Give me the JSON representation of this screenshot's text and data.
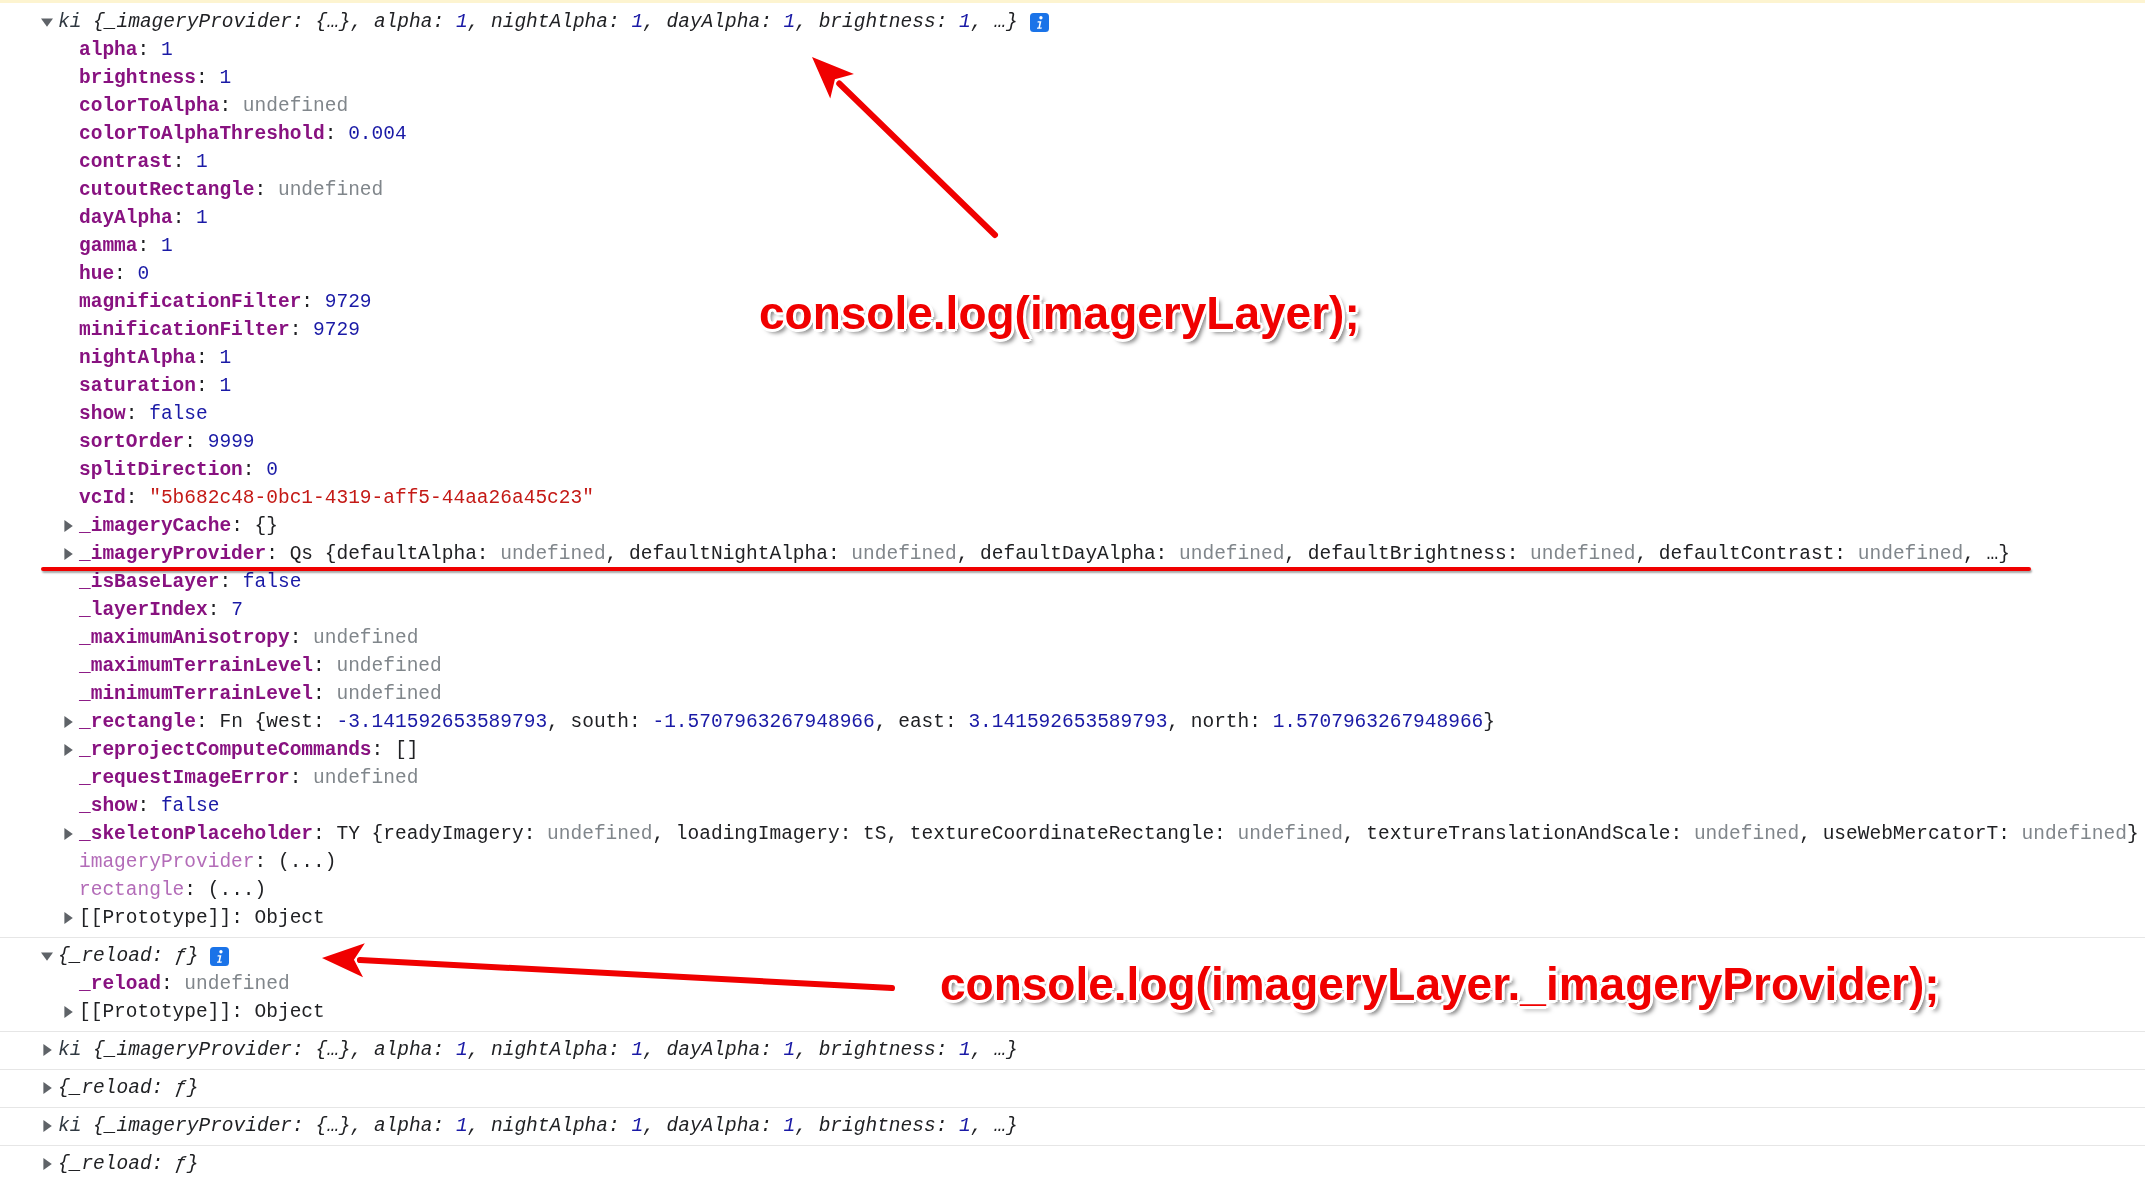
{
  "console": {
    "messages": [
      {
        "expanded": true,
        "info": true,
        "summary": [
          {
            "text": "ki ",
            "kind": "cls"
          },
          {
            "text": "{_imageryProvider: {…}, alpha: ",
            "kind": "p"
          },
          {
            "text": "1",
            "kind": "num"
          },
          {
            "text": ", nightAlpha: ",
            "kind": "p"
          },
          {
            "text": "1",
            "kind": "num"
          },
          {
            "text": ", dayAlpha: ",
            "kind": "p"
          },
          {
            "text": "1",
            "kind": "num"
          },
          {
            "text": ", brightness: ",
            "kind": "p"
          },
          {
            "text": "1",
            "kind": "num"
          },
          {
            "text": ", …}",
            "kind": "p"
          }
        ],
        "rows": [
          {
            "toggle": false,
            "key": "alpha",
            "kind": "own",
            "value": [
              {
                "text": ": ",
                "kind": "p"
              },
              {
                "text": "1",
                "kind": "num"
              }
            ]
          },
          {
            "toggle": false,
            "key": "brightness",
            "kind": "own",
            "value": [
              {
                "text": ": ",
                "kind": "p"
              },
              {
                "text": "1",
                "kind": "num"
              }
            ]
          },
          {
            "toggle": false,
            "key": "colorToAlpha",
            "kind": "own",
            "value": [
              {
                "text": ": ",
                "kind": "p"
              },
              {
                "text": "undefined",
                "kind": "undef"
              }
            ]
          },
          {
            "toggle": false,
            "key": "colorToAlphaThreshold",
            "kind": "own",
            "value": [
              {
                "text": ": ",
                "kind": "p"
              },
              {
                "text": "0.004",
                "kind": "num"
              }
            ]
          },
          {
            "toggle": false,
            "key": "contrast",
            "kind": "own",
            "value": [
              {
                "text": ": ",
                "kind": "p"
              },
              {
                "text": "1",
                "kind": "num"
              }
            ]
          },
          {
            "toggle": false,
            "key": "cutoutRectangle",
            "kind": "own",
            "value": [
              {
                "text": ": ",
                "kind": "p"
              },
              {
                "text": "undefined",
                "kind": "undef"
              }
            ]
          },
          {
            "toggle": false,
            "key": "dayAlpha",
            "kind": "own",
            "value": [
              {
                "text": ": ",
                "kind": "p"
              },
              {
                "text": "1",
                "kind": "num"
              }
            ]
          },
          {
            "toggle": false,
            "key": "gamma",
            "kind": "own",
            "value": [
              {
                "text": ": ",
                "kind": "p"
              },
              {
                "text": "1",
                "kind": "num"
              }
            ]
          },
          {
            "toggle": false,
            "key": "hue",
            "kind": "own",
            "value": [
              {
                "text": ": ",
                "kind": "p"
              },
              {
                "text": "0",
                "kind": "num"
              }
            ]
          },
          {
            "toggle": false,
            "key": "magnificationFilter",
            "kind": "own",
            "value": [
              {
                "text": ": ",
                "kind": "p"
              },
              {
                "text": "9729",
                "kind": "num"
              }
            ]
          },
          {
            "toggle": false,
            "key": "minificationFilter",
            "kind": "own",
            "value": [
              {
                "text": ": ",
                "kind": "p"
              },
              {
                "text": "9729",
                "kind": "num"
              }
            ]
          },
          {
            "toggle": false,
            "key": "nightAlpha",
            "kind": "own",
            "value": [
              {
                "text": ": ",
                "kind": "p"
              },
              {
                "text": "1",
                "kind": "num"
              }
            ]
          },
          {
            "toggle": false,
            "key": "saturation",
            "kind": "own",
            "value": [
              {
                "text": ": ",
                "kind": "p"
              },
              {
                "text": "1",
                "kind": "num"
              }
            ]
          },
          {
            "toggle": false,
            "key": "show",
            "kind": "own",
            "value": [
              {
                "text": ": ",
                "kind": "p"
              },
              {
                "text": "false",
                "kind": "bool"
              }
            ]
          },
          {
            "toggle": false,
            "key": "sortOrder",
            "kind": "own",
            "value": [
              {
                "text": ": ",
                "kind": "p"
              },
              {
                "text": "9999",
                "kind": "num"
              }
            ]
          },
          {
            "toggle": false,
            "key": "splitDirection",
            "kind": "own",
            "value": [
              {
                "text": ": ",
                "kind": "p"
              },
              {
                "text": "0",
                "kind": "num"
              }
            ]
          },
          {
            "toggle": false,
            "key": "vcId",
            "kind": "own",
            "value": [
              {
                "text": ": ",
                "kind": "p"
              },
              {
                "text": "\"5b682c48-0bc1-4319-aff5-44aa26a45c23\"",
                "kind": "str"
              }
            ]
          },
          {
            "toggle": true,
            "key": "_imageryCache",
            "kind": "own",
            "value": [
              {
                "text": ": {}",
                "kind": "p"
              }
            ]
          },
          {
            "toggle": true,
            "key": "_imageryProvider",
            "kind": "own",
            "value": [
              {
                "text": ": Qs {defaultAlpha: ",
                "kind": "p"
              },
              {
                "text": "undefined",
                "kind": "undef"
              },
              {
                "text": ", defaultNightAlpha: ",
                "kind": "p"
              },
              {
                "text": "undefined",
                "kind": "undef"
              },
              {
                "text": ", defaultDayAlpha: ",
                "kind": "p"
              },
              {
                "text": "undefined",
                "kind": "undef"
              },
              {
                "text": ", defaultBrightness: ",
                "kind": "p"
              },
              {
                "text": "undefined",
                "kind": "undef"
              },
              {
                "text": ", defaultContrast: ",
                "kind": "p"
              },
              {
                "text": "undefined",
                "kind": "undef"
              },
              {
                "text": ", …}",
                "kind": "p"
              }
            ]
          },
          {
            "toggle": false,
            "key": "_isBaseLayer",
            "kind": "own",
            "value": [
              {
                "text": ": ",
                "kind": "p"
              },
              {
                "text": "false",
                "kind": "bool"
              }
            ]
          },
          {
            "toggle": false,
            "key": "_layerIndex",
            "kind": "own",
            "value": [
              {
                "text": ": ",
                "kind": "p"
              },
              {
                "text": "7",
                "kind": "num"
              }
            ]
          },
          {
            "toggle": false,
            "key": "_maximumAnisotropy",
            "kind": "own",
            "value": [
              {
                "text": ": ",
                "kind": "p"
              },
              {
                "text": "undefined",
                "kind": "undef"
              }
            ]
          },
          {
            "toggle": false,
            "key": "_maximumTerrainLevel",
            "kind": "own",
            "value": [
              {
                "text": ": ",
                "kind": "p"
              },
              {
                "text": "undefined",
                "kind": "undef"
              }
            ]
          },
          {
            "toggle": false,
            "key": "_minimumTerrainLevel",
            "kind": "own",
            "value": [
              {
                "text": ": ",
                "kind": "p"
              },
              {
                "text": "undefined",
                "kind": "undef"
              }
            ]
          },
          {
            "toggle": true,
            "key": "_rectangle",
            "kind": "own",
            "value": [
              {
                "text": ": Fn {west: ",
                "kind": "p"
              },
              {
                "text": "-3.141592653589793",
                "kind": "num"
              },
              {
                "text": ", south: ",
                "kind": "p"
              },
              {
                "text": "-1.5707963267948966",
                "kind": "num"
              },
              {
                "text": ", east: ",
                "kind": "p"
              },
              {
                "text": "3.141592653589793",
                "kind": "num"
              },
              {
                "text": ", north: ",
                "kind": "p"
              },
              {
                "text": "1.5707963267948966",
                "kind": "num"
              },
              {
                "text": "}",
                "kind": "p"
              }
            ]
          },
          {
            "toggle": true,
            "key": "_reprojectComputeCommands",
            "kind": "own",
            "value": [
              {
                "text": ": []",
                "kind": "p"
              }
            ]
          },
          {
            "toggle": false,
            "key": "_requestImageError",
            "kind": "own",
            "value": [
              {
                "text": ": ",
                "kind": "p"
              },
              {
                "text": "undefined",
                "kind": "undef"
              }
            ]
          },
          {
            "toggle": false,
            "key": "_show",
            "kind": "own",
            "value": [
              {
                "text": ": ",
                "kind": "p"
              },
              {
                "text": "false",
                "kind": "bool"
              }
            ]
          },
          {
            "toggle": true,
            "key": "_skeletonPlaceholder",
            "kind": "own",
            "value": [
              {
                "text": ": TY {readyImagery: ",
                "kind": "p"
              },
              {
                "text": "undefined",
                "kind": "undef"
              },
              {
                "text": ", loadingImagery: tS, textureCoordinateRectangle: ",
                "kind": "p"
              },
              {
                "text": "undefined",
                "kind": "undef"
              },
              {
                "text": ", textureTranslationAndScale: ",
                "kind": "p"
              },
              {
                "text": "undefined",
                "kind": "undef"
              },
              {
                "text": ", useWebMercatorT: ",
                "kind": "p"
              },
              {
                "text": "undefined",
                "kind": "undef"
              },
              {
                "text": "}",
                "kind": "p"
              }
            ]
          },
          {
            "toggle": false,
            "key": "imageryProvider",
            "kind": "accessor",
            "value": [
              {
                "text": ": (...)",
                "kind": "p"
              }
            ]
          },
          {
            "toggle": false,
            "key": "rectangle",
            "kind": "accessor",
            "value": [
              {
                "text": ": (...)",
                "kind": "p"
              }
            ]
          },
          {
            "toggle": true,
            "key": "[[Prototype]]",
            "kind": "internal",
            "value": [
              {
                "text": ": Object",
                "kind": "p"
              }
            ]
          }
        ]
      },
      {
        "expanded": true,
        "info": true,
        "summary": [
          {
            "text": "{_reload: ƒ}",
            "kind": "p"
          }
        ],
        "rows": [
          {
            "toggle": false,
            "key": "_reload",
            "kind": "own",
            "value": [
              {
                "text": ": ",
                "kind": "p"
              },
              {
                "text": "undefined",
                "kind": "undef"
              }
            ]
          },
          {
            "toggle": true,
            "key": "[[Prototype]]",
            "kind": "internal",
            "value": [
              {
                "text": ": Object",
                "kind": "p"
              }
            ]
          }
        ]
      },
      {
        "expanded": false,
        "info": false,
        "summary": [
          {
            "text": "ki ",
            "kind": "cls"
          },
          {
            "text": "{_imageryProvider: {…}, alpha: ",
            "kind": "p"
          },
          {
            "text": "1",
            "kind": "num"
          },
          {
            "text": ", nightAlpha: ",
            "kind": "p"
          },
          {
            "text": "1",
            "kind": "num"
          },
          {
            "text": ", dayAlpha: ",
            "kind": "p"
          },
          {
            "text": "1",
            "kind": "num"
          },
          {
            "text": ", brightness: ",
            "kind": "p"
          },
          {
            "text": "1",
            "kind": "num"
          },
          {
            "text": ", …}",
            "kind": "p"
          }
        ]
      },
      {
        "expanded": false,
        "info": false,
        "summary": [
          {
            "text": "{_reload: ƒ}",
            "kind": "p"
          }
        ]
      },
      {
        "expanded": false,
        "info": false,
        "summary": [
          {
            "text": "ki ",
            "kind": "cls"
          },
          {
            "text": "{_imageryProvider: {…}, alpha: ",
            "kind": "p"
          },
          {
            "text": "1",
            "kind": "num"
          },
          {
            "text": ", nightAlpha: ",
            "kind": "p"
          },
          {
            "text": "1",
            "kind": "num"
          },
          {
            "text": ", dayAlpha: ",
            "kind": "p"
          },
          {
            "text": "1",
            "kind": "num"
          },
          {
            "text": ", brightness: ",
            "kind": "p"
          },
          {
            "text": "1",
            "kind": "num"
          },
          {
            "text": ", …}",
            "kind": "p"
          }
        ]
      },
      {
        "expanded": false,
        "info": false,
        "summary": [
          {
            "text": "{_reload: ƒ}",
            "kind": "p"
          }
        ]
      }
    ]
  },
  "annotations": [
    {
      "kind": "arrow_label",
      "text": "console.log(imageryLayer);"
    },
    {
      "kind": "underline"
    },
    {
      "kind": "arrow_label",
      "text": "console.log(imageryLayer._imageryProvider);"
    }
  ]
}
